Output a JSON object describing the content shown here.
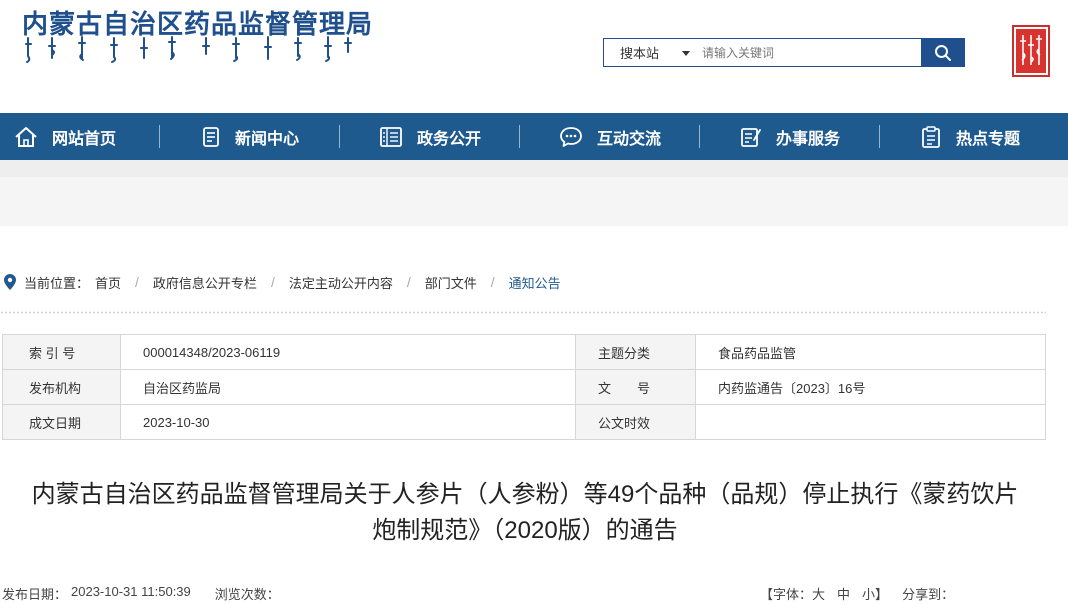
{
  "header": {
    "site_title": "内蒙古自治区药品监督管理局",
    "search": {
      "scope_label": "搜本站",
      "placeholder": "请输入关键词",
      "value": ""
    }
  },
  "nav": {
    "items": [
      {
        "label": "网站首页",
        "icon": "home-icon"
      },
      {
        "label": "新闻中心",
        "icon": "news-icon"
      },
      {
        "label": "政务公开",
        "icon": "gov-open-icon"
      },
      {
        "label": "互动交流",
        "icon": "chat-icon"
      },
      {
        "label": "办事服务",
        "icon": "service-icon"
      },
      {
        "label": "热点专题",
        "icon": "topic-icon"
      }
    ]
  },
  "breadcrumb": {
    "prefix": "当前位置：",
    "items": [
      "首页",
      "政府信息公开专栏",
      "法定主动公开内容",
      "部门文件",
      "通知公告"
    ]
  },
  "info": {
    "row1": {
      "label_a": "索 引 号",
      "value_a": "000014348/2023-06119",
      "label_b": "主题分类",
      "value_b": "食品药品监管"
    },
    "row2": {
      "label_a": "发布机构",
      "value_a": "自治区药监局",
      "label_b": "文　　号",
      "value_b": "内药监通告〔2023〕16号"
    },
    "row3": {
      "label_a": "成文日期",
      "value_a": "2023-10-30",
      "label_b": "公文时效",
      "value_b": ""
    }
  },
  "article": {
    "title_line1": "内蒙古自治区药品监督管理局关于人参片（人参粉）等49个品种（品规）停止执行《蒙药饮片",
    "title_line2": "炮制规范》（2020版）的通告",
    "publish_label": "发布日期：",
    "publish_date": "2023-10-31 11:50:39",
    "views_label": "浏览次数：",
    "views": "",
    "font_label": "【字体：",
    "font_large": "大",
    "font_medium": "中",
    "font_small": "小】",
    "share_label": "分享到："
  },
  "colors": {
    "brand_blue": "#1f5a8e",
    "seal_red": "#d9332f"
  }
}
